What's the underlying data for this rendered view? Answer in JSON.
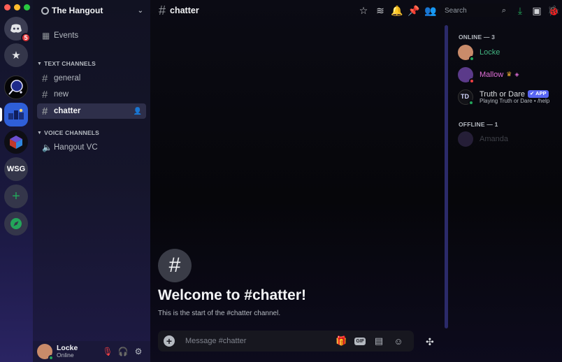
{
  "server": {
    "name": "The Hangout",
    "notification_count": "5",
    "wsg_label": "WSG"
  },
  "sidebar": {
    "events_label": "Events",
    "text_category": "TEXT CHANNELS",
    "voice_category": "VOICE CHANNELS",
    "text_channels": [
      {
        "name": "general"
      },
      {
        "name": "new"
      },
      {
        "name": "chatter"
      }
    ],
    "voice_channels": [
      {
        "name": "Hangout VC"
      }
    ]
  },
  "user": {
    "name": "Locke",
    "status": "Online"
  },
  "topbar": {
    "channel_name": "chatter",
    "search_placeholder": "Search"
  },
  "chat": {
    "welcome_title": "Welcome to #chatter!",
    "welcome_subtitle": "This is the start of the #chatter channel.",
    "message_placeholder": "Message #chatter",
    "gif_label": "GIF"
  },
  "members": {
    "online_header": "ONLINE — 3",
    "offline_header": "OFFLINE — 1",
    "online": [
      {
        "name": "Locke",
        "color": "#43b581"
      },
      {
        "name": "Mallow",
        "color": "#e06fd8"
      },
      {
        "name": "Truth or Dare",
        "tag": "APP",
        "activity": "Playing Truth or Dare • /help",
        "color": "#dbdee1"
      }
    ],
    "offline": [
      {
        "name": "Amanda",
        "color": "#5c5e66"
      }
    ]
  },
  "colors": {
    "accent": "#5865f2",
    "online": "#23a55a",
    "dnd": "#f23f43",
    "badge": "#e0363a"
  }
}
